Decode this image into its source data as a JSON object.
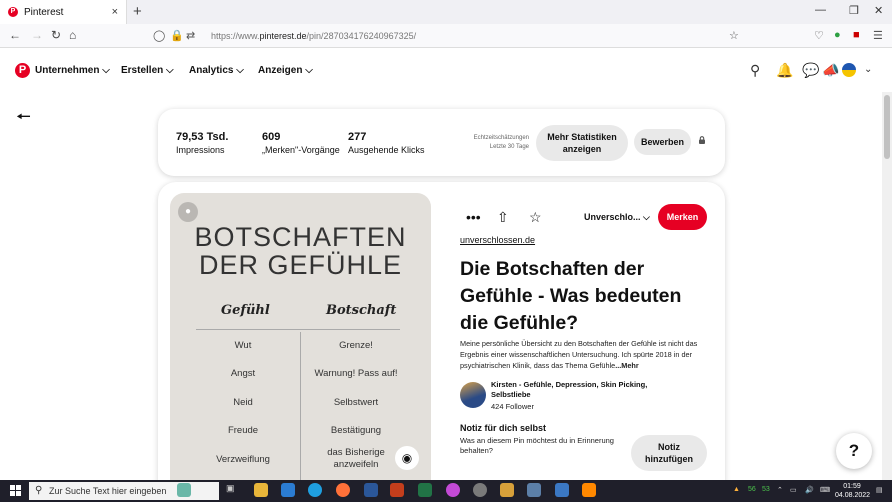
{
  "browser": {
    "tab_title": "Pinterest",
    "tab_close": "×",
    "new_tab": "+",
    "url_prefix": "https://www.",
    "url_domain": "pinterest.de",
    "url_path": "/pin/287034176240967325/"
  },
  "header": {
    "logo": "P",
    "nav": [
      "Unternehmen",
      "Erstellen",
      "Analytics",
      "Anzeigen"
    ]
  },
  "stats": {
    "items": [
      {
        "value": "79,53 Tsd.",
        "label": "Impressions"
      },
      {
        "value": "609",
        "label": "„Merken\"-Vorgänge"
      },
      {
        "value": "277",
        "label": "Ausgehende Klicks"
      }
    ],
    "estimate_line1": "Echtzeitschätzungen",
    "estimate_line2": "Letzte 30 Tage",
    "more_stats_line1": "Mehr Statistiken",
    "more_stats_line2": "anzeigen",
    "promote": "Bewerben"
  },
  "pin_image": {
    "title_line1": "BOTSCHAFTEN",
    "title_line2": "DER GEFÜHLE",
    "col1": "Gefühl",
    "col2": "Botschaft",
    "rows": [
      {
        "feeling": "Wut",
        "message": "Grenze!"
      },
      {
        "feeling": "Angst",
        "message": "Warnung! Pass auf!"
      },
      {
        "feeling": "Neid",
        "message": "Selbstwert"
      },
      {
        "feeling": "Freude",
        "message": "Bestätigung"
      },
      {
        "feeling": "Verzweiflung",
        "message": "das Bisherige anzweifeln"
      }
    ]
  },
  "pin": {
    "board": "Unverschlo...",
    "save": "Merken",
    "domain": "unverschlossen.de",
    "title": "Die Botschaften der Gefühle - Was bedeuten die Gefühle?",
    "description": "Meine persönliche Übersicht zu den Botschaften der Gefühle ist nicht das Ergebnis einer wissenschaftlichen Untersuchung. Ich spürte 2018 in der psychiatrischen Klinik, dass das Thema Gefühle",
    "more": "...Mehr",
    "user_name": "Kirsten - Gefühle, Depression, Skin Picking, Selbstliebe",
    "followers": "424 Follower",
    "note_title": "Notiz für dich selbst",
    "note_text": "Was an diesem Pin möchtest du in Erinnerung behalten?",
    "note_button_line1": "Notiz",
    "note_button_line2": "hinzufügen"
  },
  "help": "?",
  "taskbar": {
    "search_placeholder": "Zur Suche Text hier eingeben",
    "time": "01:59",
    "date": "04.08.2022",
    "tray_a": "56",
    "tray_b": "53"
  }
}
